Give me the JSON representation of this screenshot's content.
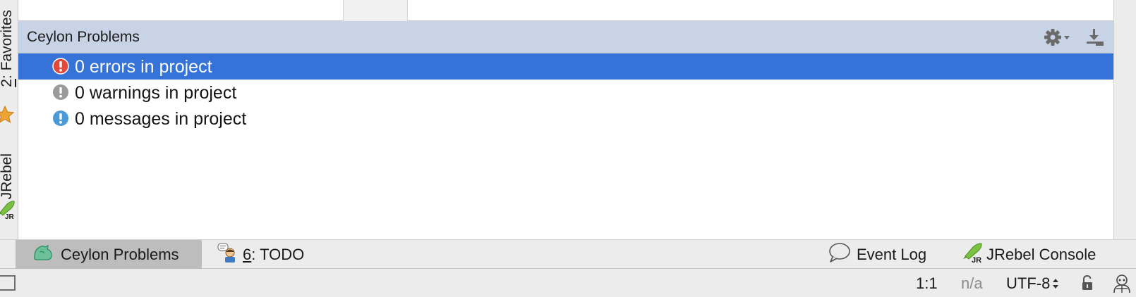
{
  "left_strip": {
    "favorites": {
      "number": "2",
      "label": ": Favorites",
      "icon": "star-icon"
    },
    "jrebel": {
      "label": "JRebel",
      "icon": "jrebel-rocket-icon"
    }
  },
  "tool_window": {
    "title": "Ceylon Problems",
    "actions": [
      {
        "name": "settings",
        "icon": "gear-icon"
      },
      {
        "name": "hide",
        "icon": "hide-panel-icon"
      }
    ],
    "problems": [
      {
        "text": "0 errors in project",
        "icon": "error-icon",
        "icon_color": "#e2483c",
        "selected": true
      },
      {
        "text": "0 warnings in project",
        "icon": "warning-icon",
        "icon_color": "#9a9a9a",
        "selected": false
      },
      {
        "text": "0 messages in project",
        "icon": "info-icon",
        "icon_color": "#4a9ad8",
        "selected": false
      }
    ],
    "selection_color": "#3573d8",
    "header_color": "#c8d3e5"
  },
  "bottom_bar": {
    "tabs": [
      {
        "label": "Ceylon Problems",
        "icon": "ceylon-icon",
        "active": true
      },
      {
        "number": "6",
        "label": ": TODO",
        "icon": "todo-icon",
        "active": false
      },
      {
        "label": "Event Log",
        "icon": "event-log-icon",
        "active": false
      },
      {
        "label": "JRebel Console",
        "icon": "jrebel-rocket-icon",
        "active": false
      }
    ]
  },
  "status_bar": {
    "position": "1:1",
    "na": "n/a",
    "encoding": "UTF-8"
  }
}
